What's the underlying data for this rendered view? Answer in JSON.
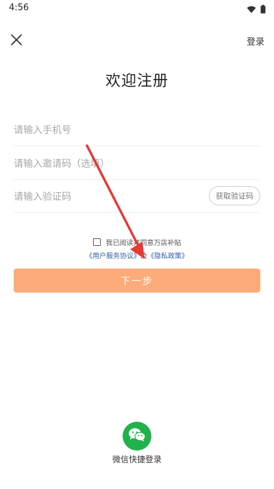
{
  "status_bar": {
    "time": "4:56",
    "icons": [
      "wifi-icon",
      "battery-icon"
    ]
  },
  "header": {
    "close_icon": "close-icon",
    "login_label": "登录"
  },
  "page": {
    "title": "欢迎注册"
  },
  "form": {
    "phone_placeholder": "请输入手机号",
    "phone_value": "",
    "invite_placeholder": "请输入邀请码（选填）",
    "invite_value": "",
    "code_placeholder": "请输入验证码",
    "code_value": "",
    "get_code_label": "获取验证码"
  },
  "agreement": {
    "checked": false,
    "text": "我已阅读并同意万店补贴",
    "user_agreement": "《用户服务协议》",
    "and": "及",
    "privacy_policy": "《隐私政策》"
  },
  "next_button": {
    "label": "下一步"
  },
  "wechat": {
    "icon": "wechat-icon",
    "label": "微信快捷登录"
  },
  "colors": {
    "accent": "#fdab79",
    "link": "#2e5fa8",
    "wechat_green": "#22b24b",
    "arrow_red": "#e53935"
  }
}
